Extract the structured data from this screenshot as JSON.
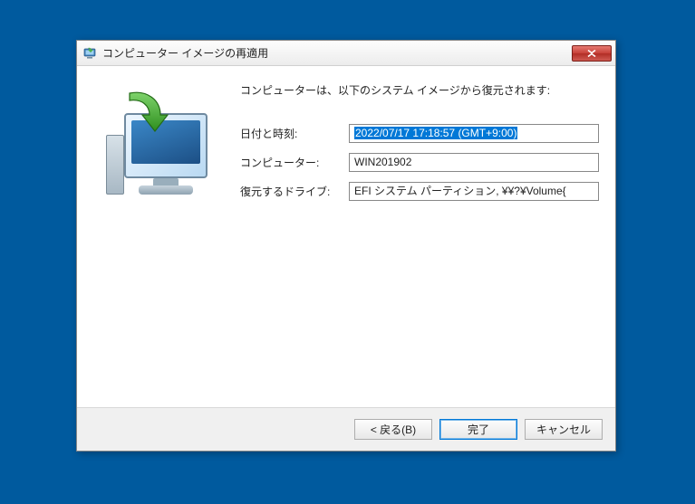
{
  "dialog": {
    "title": "コンピューター イメージの再適用",
    "intro": "コンピューターは、以下のシステム イメージから復元されます:",
    "fields": {
      "datetime": {
        "label": "日付と時刻:",
        "value": "2022/07/17 17:18:57 (GMT+9:00)"
      },
      "computer": {
        "label": "コンピューター:",
        "value": "WIN201902"
      },
      "drives": {
        "label": "復元するドライブ:",
        "value": "EFI システム パーティション, ¥¥?¥Volume{"
      }
    },
    "buttons": {
      "back": "< 戻る(B)",
      "finish": "完了",
      "cancel": "キャンセル"
    }
  }
}
